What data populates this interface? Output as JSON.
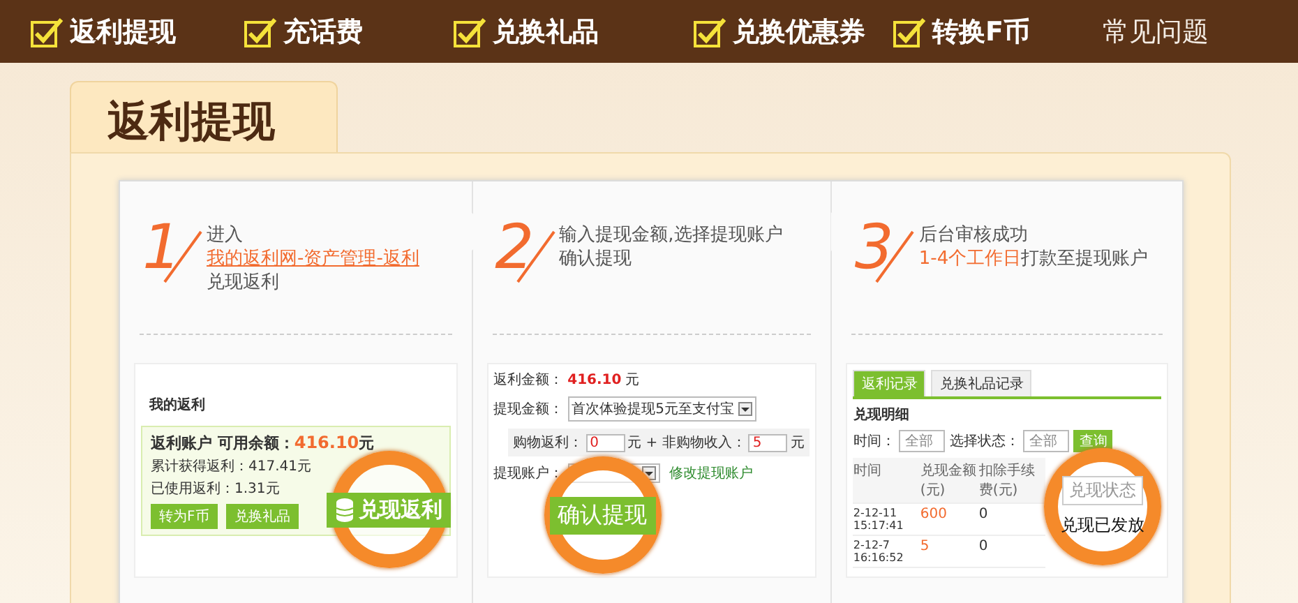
{
  "nav": [
    {
      "label": "返利提现",
      "checked": true
    },
    {
      "label": "充话费",
      "checked": true
    },
    {
      "label": "兑换礼品",
      "checked": true
    },
    {
      "label": "兑换优惠券",
      "checked": true
    },
    {
      "label": "转换F币",
      "checked": true
    },
    {
      "label": "常见问题",
      "checked": false
    }
  ],
  "page_tab": "返利提现",
  "steps": [
    {
      "number": "1",
      "lines": [
        {
          "kind": "plain",
          "text": "进入"
        },
        {
          "kind": "link",
          "text": "我的返利网-资产管理-返利"
        },
        {
          "kind": "plain",
          "text": "兑现返利"
        }
      ],
      "screen": {
        "kind": "balance",
        "heading": "我的返利",
        "balance_label": "返利账户 可用余额：",
        "balance": "416.10",
        "unit": "元",
        "stats": [
          "累计获得返利：417.41元",
          "已使用返利：1.31元"
        ],
        "buttons": [
          "转为F币",
          "兑换礼品"
        ],
        "magnified_button": "兑现返利"
      }
    },
    {
      "number": "2",
      "lines": [
        {
          "kind": "plain",
          "text": "输入提现金额,选择提现账户"
        },
        {
          "kind": "plain",
          "text": "确认提现"
        }
      ],
      "screen": {
        "kind": "withdraw",
        "amount_label": "返利金额：",
        "amount": "416.10",
        "unit": "元",
        "withdraw_label": "提现金额：",
        "withdraw_option": "首次体验提现5元至支付宝",
        "split": [
          {
            "label": "购物返利：",
            "value": "0"
          },
          {
            "label": "元 + 非购物收入：",
            "value": "5"
          }
        ],
        "split_unit": "元",
        "account_label": "提现账户：",
        "account_link": "修改提现账户",
        "magnified_button": "确认提现"
      }
    },
    {
      "number": "3",
      "lines": [
        {
          "kind": "plain",
          "text": "后台审核成功"
        },
        {
          "kind": "rich",
          "text": "**1-4个工作日**打款至提现账户"
        }
      ],
      "screen": {
        "kind": "records",
        "tabs": [
          {
            "label": "返利记录",
            "selected": true
          },
          {
            "label": "兑换礼品记录",
            "selected": false
          }
        ],
        "section": "兑现明细",
        "filters": [
          {
            "label": "时间：",
            "value": "全部"
          },
          {
            "label": "选择状态：",
            "value": "全部"
          }
        ],
        "query_button": "查询",
        "columns": [
          "时间",
          "兑现金额(元)",
          "扣除手续费(元)"
        ],
        "rows": [
          [
            "2-12-11 15:17:41",
            "600",
            "0"
          ],
          [
            "2-12-7 16:16:52",
            "5",
            "0"
          ]
        ],
        "magnified_header": "兑现状态",
        "magnified_value": "兑现已发放"
      }
    }
  ]
}
